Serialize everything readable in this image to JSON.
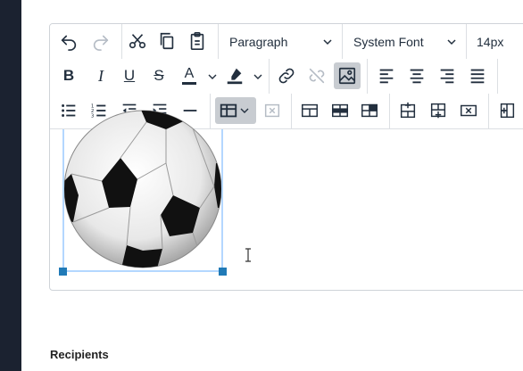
{
  "toolbar": {
    "block_format": "Paragraph",
    "font_family": "System Font",
    "font_size": "14px",
    "bold_label": "B",
    "italic_label": "I",
    "underline_label": "U",
    "strike_label": "S",
    "text_color_label": "A",
    "text_color": "#e03e2d"
  },
  "editor": {
    "image_alt": "soccer ball"
  },
  "recipients": {
    "label": "Recipients"
  },
  "colors": {
    "sidebar": "#1b2230",
    "selection_handle": "#207ab7",
    "selection_border": "#b4d7ff",
    "active_button": "#c8ccd1"
  }
}
